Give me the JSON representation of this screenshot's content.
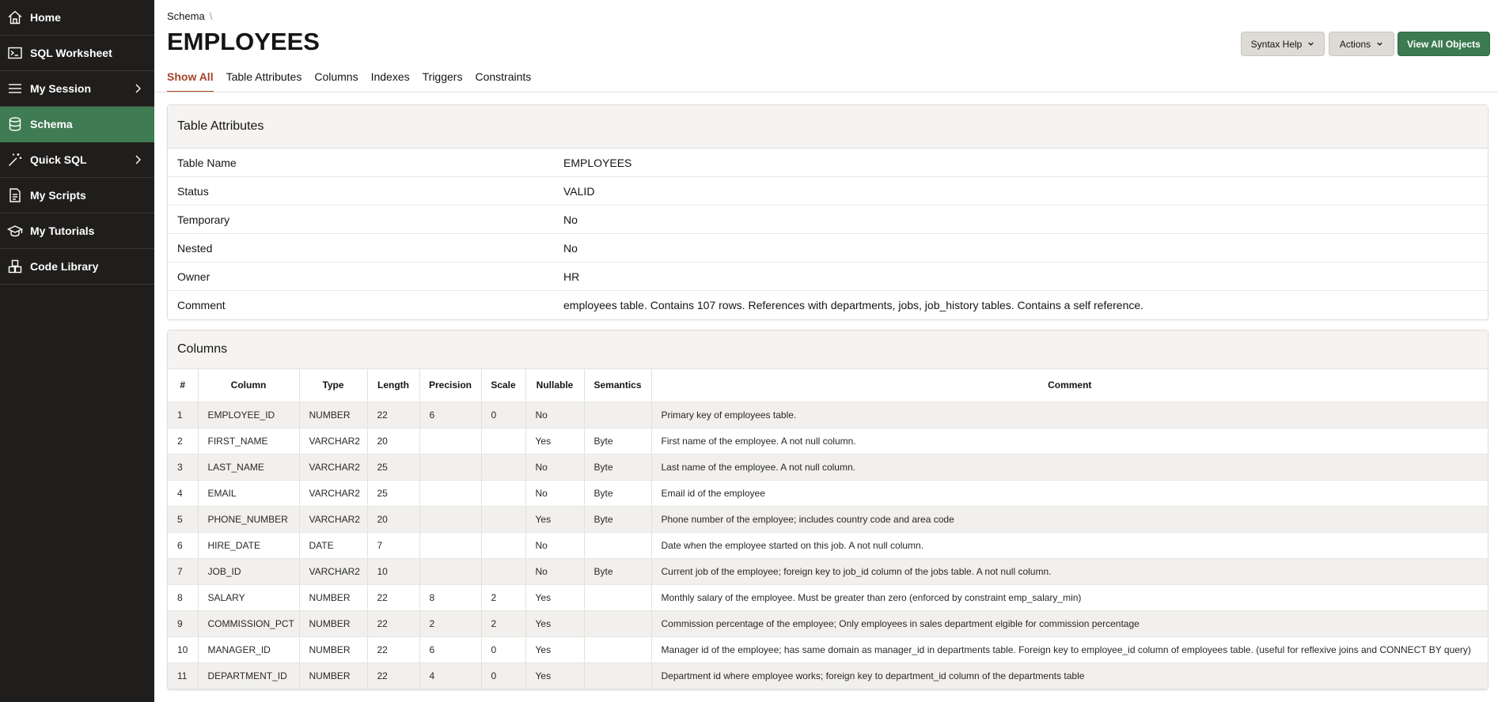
{
  "sidebar": {
    "items": [
      {
        "label": "Home",
        "icon": "home-icon",
        "chevron": false
      },
      {
        "label": "SQL Worksheet",
        "icon": "terminal-icon",
        "chevron": false
      },
      {
        "label": "My Session",
        "icon": "list-icon",
        "chevron": true
      },
      {
        "label": "Schema",
        "icon": "database-icon",
        "chevron": false,
        "active": true
      },
      {
        "label": "Quick SQL",
        "icon": "magic-wand-icon",
        "chevron": true
      },
      {
        "label": "My Scripts",
        "icon": "document-icon",
        "chevron": false
      },
      {
        "label": "My Tutorials",
        "icon": "graduation-cap-icon",
        "chevron": false
      },
      {
        "label": "Code Library",
        "icon": "blocks-icon",
        "chevron": false
      }
    ],
    "background": "#201e1c",
    "active_color": "#3f7b53"
  },
  "header": {
    "breadcrumb": "Schema",
    "breadcrumb_sep": "\\",
    "title": "EMPLOYEES"
  },
  "buttons": {
    "syntax_help": "Syntax Help",
    "actions": "Actions",
    "view_all": "View All Objects"
  },
  "tabs": [
    {
      "label": "Show All",
      "active": true
    },
    {
      "label": "Table Attributes"
    },
    {
      "label": "Columns"
    },
    {
      "label": "Indexes"
    },
    {
      "label": "Triggers"
    },
    {
      "label": "Constraints"
    }
  ],
  "attributes": {
    "heading": "Table Attributes",
    "rows": [
      {
        "key": "Table Name",
        "value": "EMPLOYEES"
      },
      {
        "key": "Status",
        "value": "VALID"
      },
      {
        "key": "Temporary",
        "value": "No"
      },
      {
        "key": "Nested",
        "value": "No"
      },
      {
        "key": "Owner",
        "value": "HR"
      },
      {
        "key": "Comment",
        "value": "employees table. Contains 107 rows. References with departments, jobs, job_history tables. Contains a self reference."
      }
    ]
  },
  "columns": {
    "heading": "Columns",
    "headers": [
      "#",
      "Column",
      "Type",
      "Length",
      "Precision",
      "Scale",
      "Nullable",
      "Semantics",
      "Comment"
    ],
    "rows": [
      [
        "1",
        "EMPLOYEE_ID",
        "NUMBER",
        "22",
        "6",
        "0",
        "No",
        "",
        "Primary key of employees table."
      ],
      [
        "2",
        "FIRST_NAME",
        "VARCHAR2",
        "20",
        "",
        "",
        "Yes",
        "Byte",
        "First name of the employee. A not null column."
      ],
      [
        "3",
        "LAST_NAME",
        "VARCHAR2",
        "25",
        "",
        "",
        "No",
        "Byte",
        "Last name of the employee. A not null column."
      ],
      [
        "4",
        "EMAIL",
        "VARCHAR2",
        "25",
        "",
        "",
        "No",
        "Byte",
        "Email id of the employee"
      ],
      [
        "5",
        "PHONE_NUMBER",
        "VARCHAR2",
        "20",
        "",
        "",
        "Yes",
        "Byte",
        "Phone number of the employee; includes country code and area code"
      ],
      [
        "6",
        "HIRE_DATE",
        "DATE",
        "7",
        "",
        "",
        "No",
        "",
        "Date when the employee started on this job. A not null column."
      ],
      [
        "7",
        "JOB_ID",
        "VARCHAR2",
        "10",
        "",
        "",
        "No",
        "Byte",
        "Current job of the employee; foreign key to job_id column of the jobs table. A not null column."
      ],
      [
        "8",
        "SALARY",
        "NUMBER",
        "22",
        "8",
        "2",
        "Yes",
        "",
        "Monthly salary of the employee. Must be greater than zero (enforced by constraint emp_salary_min)"
      ],
      [
        "9",
        "COMMISSION_PCT",
        "NUMBER",
        "22",
        "2",
        "2",
        "Yes",
        "",
        "Commission percentage of the employee; Only employees in sales department elgible for commission percentage"
      ],
      [
        "10",
        "MANAGER_ID",
        "NUMBER",
        "22",
        "6",
        "0",
        "Yes",
        "",
        "Manager id of the employee; has same domain as manager_id in departments table. Foreign key to employee_id column of employees table. (useful for reflexive joins and CONNECT BY query)"
      ],
      [
        "11",
        "DEPARTMENT_ID",
        "NUMBER",
        "22",
        "4",
        "0",
        "Yes",
        "",
        "Department id where employee works; foreign key to department_id column of the departments table"
      ]
    ]
  }
}
